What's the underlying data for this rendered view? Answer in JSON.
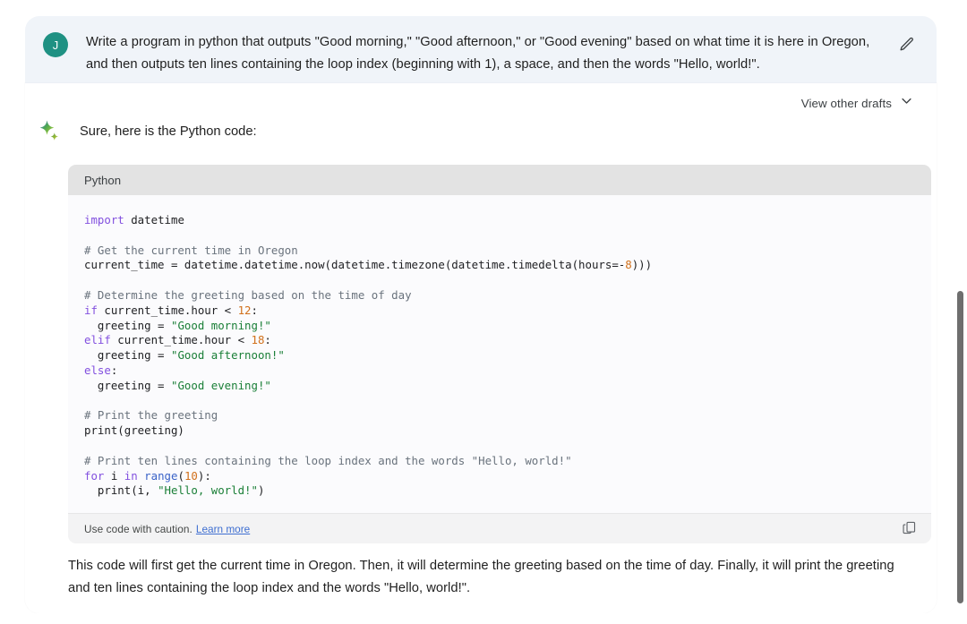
{
  "user_message": {
    "avatar_initial": "J",
    "avatar_color": "#1f9183",
    "text": "Write a program in python that outputs \"Good morning,\" \"Good afternoon,\" or \"Good evening\" based on what time it is here in Oregon, and then outputs ten lines containing the loop index (beginning with 1), a space, and then the words \"Hello, world!\".",
    "edit_icon": "pencil-icon"
  },
  "response": {
    "drafts_label": "View other drafts",
    "drafts_chevron": "chevron-down-icon",
    "model_icon": "sparkle-icon",
    "intro_text": "Sure, here is the Python code:",
    "closing_text": "This code will first get the current time in Oregon. Then, it will determine the greeting based on the time of day. Finally, it will print the greeting and ten lines containing the loop index and the words \"Hello, world!\"."
  },
  "code_block": {
    "language_label": "Python",
    "caution_text": "Use code with caution.",
    "learn_more_label": "Learn more",
    "copy_icon": "copy-icon",
    "code": "import datetime\n\n# Get the current time in Oregon\ncurrent_time = datetime.datetime.now(datetime.timezone(datetime.timedelta(hours=-8)))\n\n# Determine the greeting based on the time of day\nif current_time.hour < 12:\n  greeting = \"Good morning!\"\nelif current_time.hour < 18:\n  greeting = \"Good afternoon!\"\nelse:\n  greeting = \"Good evening!\"\n\n# Print the greeting\nprint(greeting)\n\n# Print ten lines containing the loop index and the words \"Hello, world!\"\nfor i in range(10):\n  print(i, \"Hello, world!\")",
    "tokens": [
      [
        {
          "t": "import",
          "c": "kw"
        },
        {
          "t": " datetime",
          "c": "pl"
        }
      ],
      [],
      [
        {
          "t": "# Get the current time in Oregon",
          "c": "cm"
        }
      ],
      [
        {
          "t": "current_time = datetime.datetime.now(datetime.timezone(datetime.timedelta(hours=-",
          "c": "pl"
        },
        {
          "t": "8",
          "c": "num"
        },
        {
          "t": ")))",
          "c": "pl"
        }
      ],
      [],
      [
        {
          "t": "# Determine the greeting based on the time of day",
          "c": "cm"
        }
      ],
      [
        {
          "t": "if",
          "c": "kw"
        },
        {
          "t": " current_time.hour < ",
          "c": "pl"
        },
        {
          "t": "12",
          "c": "num"
        },
        {
          "t": ":",
          "c": "pl"
        }
      ],
      [
        {
          "t": "  greeting = ",
          "c": "pl"
        },
        {
          "t": "\"Good morning!\"",
          "c": "str"
        }
      ],
      [
        {
          "t": "elif",
          "c": "kw"
        },
        {
          "t": " current_time.hour < ",
          "c": "pl"
        },
        {
          "t": "18",
          "c": "num"
        },
        {
          "t": ":",
          "c": "pl"
        }
      ],
      [
        {
          "t": "  greeting = ",
          "c": "pl"
        },
        {
          "t": "\"Good afternoon!\"",
          "c": "str"
        }
      ],
      [
        {
          "t": "else",
          "c": "kw"
        },
        {
          "t": ":",
          "c": "pl"
        }
      ],
      [
        {
          "t": "  greeting = ",
          "c": "pl"
        },
        {
          "t": "\"Good evening!\"",
          "c": "str"
        }
      ],
      [],
      [
        {
          "t": "# Print the greeting",
          "c": "cm"
        }
      ],
      [
        {
          "t": "print(greeting)",
          "c": "pl"
        }
      ],
      [],
      [
        {
          "t": "# Print ten lines containing the loop index and the words \"Hello, world!\"",
          "c": "cm"
        }
      ],
      [
        {
          "t": "for",
          "c": "kw"
        },
        {
          "t": " i ",
          "c": "pl"
        },
        {
          "t": "in",
          "c": "kw"
        },
        {
          "t": " ",
          "c": "pl"
        },
        {
          "t": "range",
          "c": "fn"
        },
        {
          "t": "(",
          "c": "pl"
        },
        {
          "t": "10",
          "c": "num"
        },
        {
          "t": "):",
          "c": "pl"
        }
      ],
      [
        {
          "t": "  print(i, ",
          "c": "pl"
        },
        {
          "t": "\"Hello, world!\"",
          "c": "str"
        },
        {
          "t": ")",
          "c": "pl"
        }
      ]
    ]
  },
  "colors": {
    "user_bubble_bg": "#f0f4f9",
    "card_bg": "#ffffff",
    "code_header_bg": "#e3e3e3",
    "code_body_bg": "#fbfbfd",
    "link_blue": "#3f6fd1",
    "keyword_purple": "#8250df",
    "string_green": "#1a7f37",
    "number_orange": "#d1701b",
    "comment_gray": "#6a737d",
    "scrollbar_thumb": "#6e6e6e"
  }
}
